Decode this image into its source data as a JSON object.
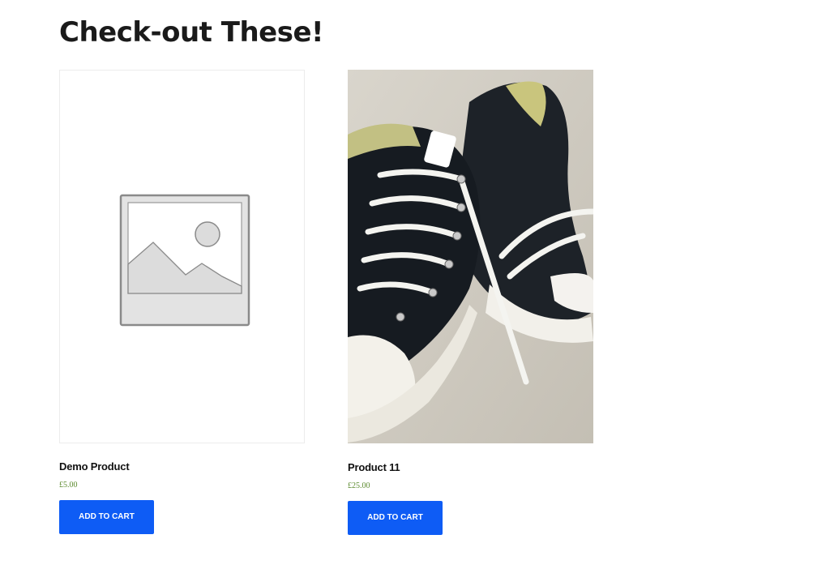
{
  "section": {
    "title": "Check-out These!"
  },
  "products": [
    {
      "name": "Demo Product",
      "price": "£5.00",
      "button_label": "ADD TO CART",
      "image": "placeholder-image-icon"
    },
    {
      "name": "Product 11",
      "price": "£25.00",
      "button_label": "ADD TO CART",
      "image": "sneakers-photo"
    }
  ],
  "colors": {
    "button_bg": "#0e5cf5",
    "price": "#5b8a2e",
    "title": "#1a1a1a"
  }
}
